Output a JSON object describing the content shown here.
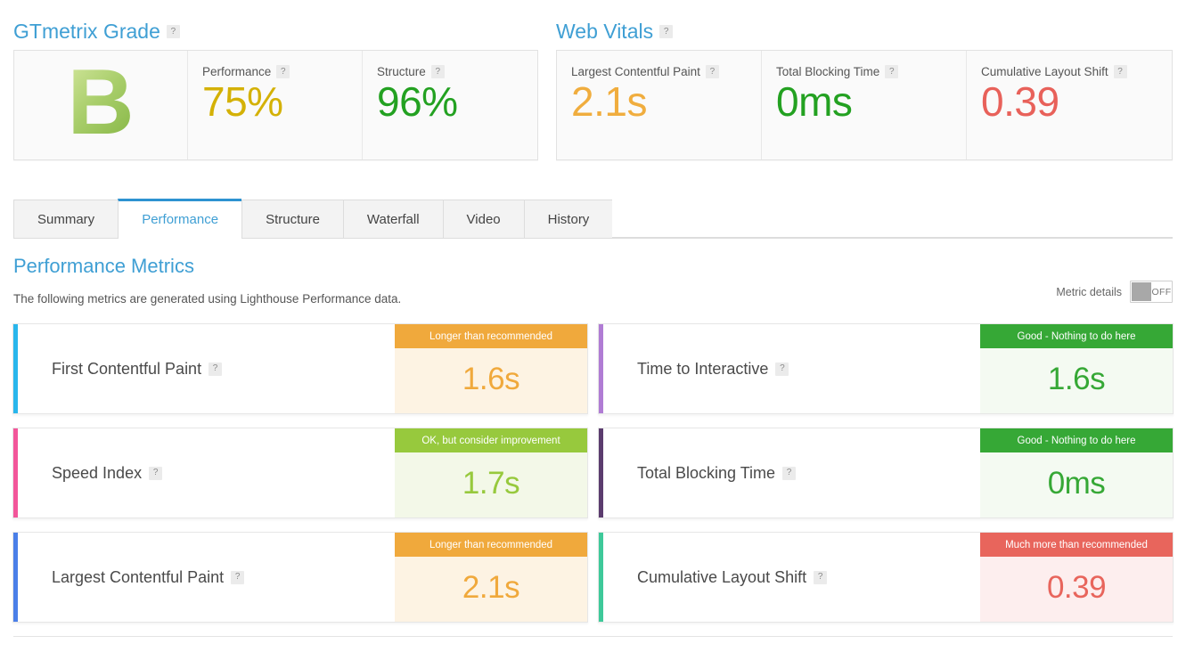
{
  "grade_section": {
    "title": "GTmetrix Grade",
    "help_icon": "help-icon",
    "grade_letter": "B",
    "metrics": [
      {
        "label": "Performance",
        "value": "75%",
        "color": "#d4b106"
      },
      {
        "label": "Structure",
        "value": "96%",
        "color": "#23a121"
      }
    ]
  },
  "vitals_section": {
    "title": "Web Vitals",
    "help_icon": "help-icon",
    "metrics": [
      {
        "label": "Largest Contentful Paint",
        "value": "2.1s",
        "color": "#f0ad3e"
      },
      {
        "label": "Total Blocking Time",
        "value": "0ms",
        "color": "#23a121"
      },
      {
        "label": "Cumulative Layout Shift",
        "value": "0.39",
        "color": "#e8615a"
      }
    ]
  },
  "tabs": [
    {
      "label": "Summary",
      "active": false
    },
    {
      "label": "Performance",
      "active": true
    },
    {
      "label": "Structure",
      "active": false
    },
    {
      "label": "Waterfall",
      "active": false
    },
    {
      "label": "Video",
      "active": false
    },
    {
      "label": "History",
      "active": false
    }
  ],
  "performance_metrics": {
    "title": "Performance Metrics",
    "description": "The following metrics are generated using Lighthouse Performance data.",
    "toggle": {
      "label": "Metric details",
      "state": "OFF"
    },
    "cards": [
      {
        "name": "first-contentful-paint",
        "label": "First Contentful Paint",
        "value": "1.6s",
        "banner": "Longer than recommended",
        "accent_color": "#29b6ec",
        "banner_color": "#f0a93c",
        "value_color": "#f0a93c",
        "value_bg": "#fdf3e3"
      },
      {
        "name": "time-to-interactive",
        "label": "Time to Interactive",
        "value": "1.6s",
        "banner": "Good - Nothing to do here",
        "accent_color": "#b07cd4",
        "banner_color": "#36a836",
        "value_color": "#36a836",
        "value_bg": "#f4faf2"
      },
      {
        "name": "speed-index",
        "label": "Speed Index",
        "value": "1.7s",
        "banner": "OK, but consider improvement",
        "accent_color": "#f2569a",
        "banner_color": "#97c93d",
        "value_color": "#97c93d",
        "value_bg": "#f3f8e8"
      },
      {
        "name": "total-blocking-time",
        "label": "Total Blocking Time",
        "value": "0ms",
        "banner": "Good - Nothing to do here",
        "accent_color": "#5b3c6e",
        "banner_color": "#36a836",
        "value_color": "#36a836",
        "value_bg": "#f4faf2"
      },
      {
        "name": "largest-contentful-paint",
        "label": "Largest Contentful Paint",
        "value": "2.1s",
        "banner": "Longer than recommended",
        "accent_color": "#4a7fe8",
        "banner_color": "#f0a93c",
        "value_color": "#f0a93c",
        "value_bg": "#fdf3e3"
      },
      {
        "name": "cumulative-layout-shift",
        "label": "Cumulative Layout Shift",
        "value": "0.39",
        "banner": "Much more than recommended",
        "accent_color": "#3ec99a",
        "banner_color": "#e8655c",
        "value_color": "#e8655c",
        "value_bg": "#fdeeee"
      }
    ]
  },
  "help_glyph": "?"
}
